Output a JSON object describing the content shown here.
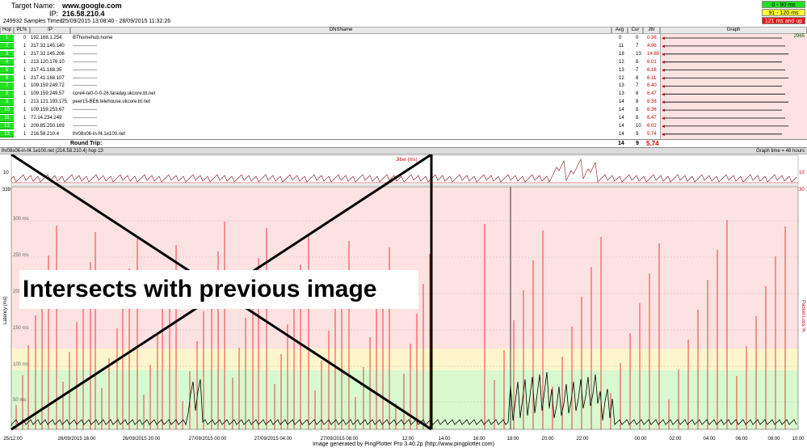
{
  "header": {
    "target_name_label": "Target Name:",
    "target_name": "www.google.com",
    "ip_label": "IP:",
    "ip": "216.58.210.4",
    "samples": "249932 Samples Timed:",
    "time_range": "25/09/2015 13:08:40 - 28/09/2015 11:32:26",
    "legend": [
      {
        "text": "0 - 90 ms",
        "bg": "#22dd22"
      },
      {
        "text": "91 - 120 ms",
        "bg": "#ffff33"
      },
      {
        "text": "121 ms and up",
        "bg": "#ee1111"
      }
    ]
  },
  "table": {
    "headers": [
      "Hop",
      "PL%",
      "IP",
      "DNSName",
      "Avg",
      "Cur",
      "Jttr",
      "Graph"
    ],
    "hops": [
      {
        "hop": "1",
        "pl": "0",
        "ip": "192.168.1.254",
        "dns": "BThomehub.home",
        "avg": "0",
        "cur": "0",
        "jttr": "0.38"
      },
      {
        "hop": "2",
        "pl": "1",
        "ip": "217.32.145.140",
        "dns": "---------------",
        "avg": "11",
        "cur": "7",
        "jttr": "4.96"
      },
      {
        "hop": "3",
        "pl": "1",
        "ip": "217.32.145.206",
        "dns": "---------------",
        "avg": "18",
        "cur": "13",
        "jttr": "14.89"
      },
      {
        "hop": "4",
        "pl": "1",
        "ip": "213.120.176.10",
        "dns": "---------------",
        "avg": "12",
        "cur": "8",
        "jttr": "6.01"
      },
      {
        "hop": "5",
        "pl": "1",
        "ip": "217.41.168.35",
        "dns": "---------------",
        "avg": "13",
        "cur": "7",
        "jttr": "6.18"
      },
      {
        "hop": "6",
        "pl": "1",
        "ip": "217.41.168.107",
        "dns": "---------------",
        "avg": "12",
        "cur": "8",
        "jttr": "6.11"
      },
      {
        "hop": "7",
        "pl": "1",
        "ip": "109.159.249.72",
        "dns": "---------------",
        "avg": "13",
        "cur": "7",
        "jttr": "6.40"
      },
      {
        "hop": "8",
        "pl": "1",
        "ip": "109.159.249.57",
        "dns": "core4-te0-0-0-26.faraday.ukcore.bt.net",
        "avg": "13",
        "cur": "8",
        "jttr": "6.47"
      },
      {
        "hop": "9",
        "pl": "1",
        "ip": "213.121.193.175",
        "dns": "peer15-BE6.telehouse.ukcore.bt.net",
        "avg": "14",
        "cur": "8",
        "jttr": "6.38"
      },
      {
        "hop": "10",
        "pl": "1",
        "ip": "109.159.253.67",
        "dns": "---------------",
        "avg": "14",
        "cur": "8",
        "jttr": "6.36"
      },
      {
        "hop": "11",
        "pl": "1",
        "ip": "72.14.234.249",
        "dns": "---------------",
        "avg": "14",
        "cur": "8",
        "jttr": "6.47"
      },
      {
        "hop": "12",
        "pl": "1",
        "ip": "209.85.250.169",
        "dns": "---------------",
        "avg": "14",
        "cur": "10",
        "jttr": "6.02"
      },
      {
        "hop": "13",
        "pl": "1",
        "ip": "216.58.210.4",
        "dns": "lhr08s06-in-f4.1e100.net",
        "avg": "14",
        "cur": "9",
        "jttr": "5.74"
      }
    ],
    "graph_max_label": "2965",
    "round_trip_label": "Round Trip:",
    "round_trip_avg": "14",
    "round_trip_cur": "9",
    "round_trip_jttr": "5.74"
  },
  "graph": {
    "title_left": "lhr08s06-in-f4.1e100.net (216.58.210.4) hop 13",
    "title_right": "Graph time = 48 hours",
    "jitter_label": "Jitter (ms)",
    "jitter_top_tick_left": "10",
    "jitter_top_tick_right": "10",
    "latency_axis_label": "Latency (ms)",
    "packet_loss_axis_label": "Packet Loss %",
    "ytop_label": "339",
    "ytop_right_label": "30",
    "y_ticks": [
      "300 ms",
      "250 ms",
      "200 ms",
      "150 ms",
      "100 ms",
      "50 ms"
    ],
    "time_ticks": [
      "25/12:00",
      "26/09/2015 16:00",
      "26/09/2015 20:00",
      "27/09/2015 00:00",
      "27/09/2015 04:00",
      "27/09/2015 08:00",
      "12:00",
      "14:00",
      "16:00",
      "18:00",
      "20:00",
      "22:00",
      "00:00",
      "02:00",
      "04:00",
      "06:00",
      "08:00",
      "10:00"
    ],
    "overlay_text": "Intersects with previous image",
    "colors": {
      "green_band": "#d8f8d0",
      "yellow_band": "#fdf6cc",
      "red_band": "#fde2e2",
      "loss": "#ee1111",
      "latency": "#000000"
    }
  },
  "footer": "Image generated by PingPlotter Pro 3.40.2p (http://www.pingplotter.com)"
}
